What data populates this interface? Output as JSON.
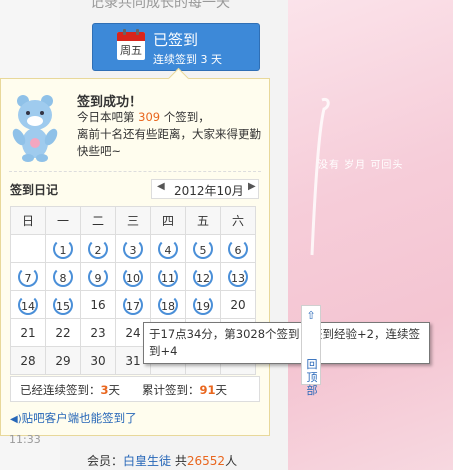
{
  "header": {
    "slogan": "记录共同成长的每一天"
  },
  "sign_button": {
    "icon_day": "周五",
    "title": "已签到",
    "subtitle": "连续签到 3 天"
  },
  "popup": {
    "title": "签到成功！",
    "line1_prefix": "今日本吧第 ",
    "rank": "309",
    "line1_suffix": " 个签到，",
    "line2": "离前十名还有些距离，大家来得更勤",
    "line3": "快些吧~",
    "calendar_label": "签到日记",
    "month": "2012年10月",
    "weekdays": [
      "日",
      "一",
      "二",
      "三",
      "四",
      "五",
      "六"
    ],
    "weeks": [
      [
        "",
        "1",
        "2",
        "3",
        "4",
        "5",
        "6"
      ],
      [
        "7",
        "8",
        "9",
        "10",
        "11",
        "12",
        "13"
      ],
      [
        "14",
        "15",
        "16",
        "17",
        "18",
        "19",
        "20"
      ],
      [
        "21",
        "22",
        "23",
        "24",
        "",
        "",
        ""
      ],
      [
        "28",
        "29",
        "30",
        "31",
        "",
        "",
        ""
      ]
    ],
    "signed_days": [
      "1",
      "2",
      "3",
      "4",
      "5",
      "6",
      "7",
      "8",
      "9",
      "10",
      "11",
      "12",
      "13",
      "14",
      "15",
      "17",
      "18",
      "19"
    ],
    "streak_label": "已经连续签到：",
    "streak_value": "3",
    "streak_unit": "天",
    "total_label": "累计签到：",
    "total_value": "91",
    "total_unit": "天",
    "client_link": "贴吧客户端也能签到了"
  },
  "tooltip": {
    "text": "于17点34分，第3028个签到，签到经验+2，连续签到+4"
  },
  "scroll_top": {
    "label": "回顶部"
  },
  "pink_text": "没有 岁月 可回头",
  "bottom": {
    "time": "11:33",
    "member_label": "会员：",
    "member_title": "白皇生徒",
    "total_prefix": "共",
    "member_count": "26552",
    "member_unit": "人"
  },
  "colors": {
    "accent_blue": "#3d89d8",
    "highlight_orange": "#e9661e",
    "popup_bg": "#fffdee"
  }
}
